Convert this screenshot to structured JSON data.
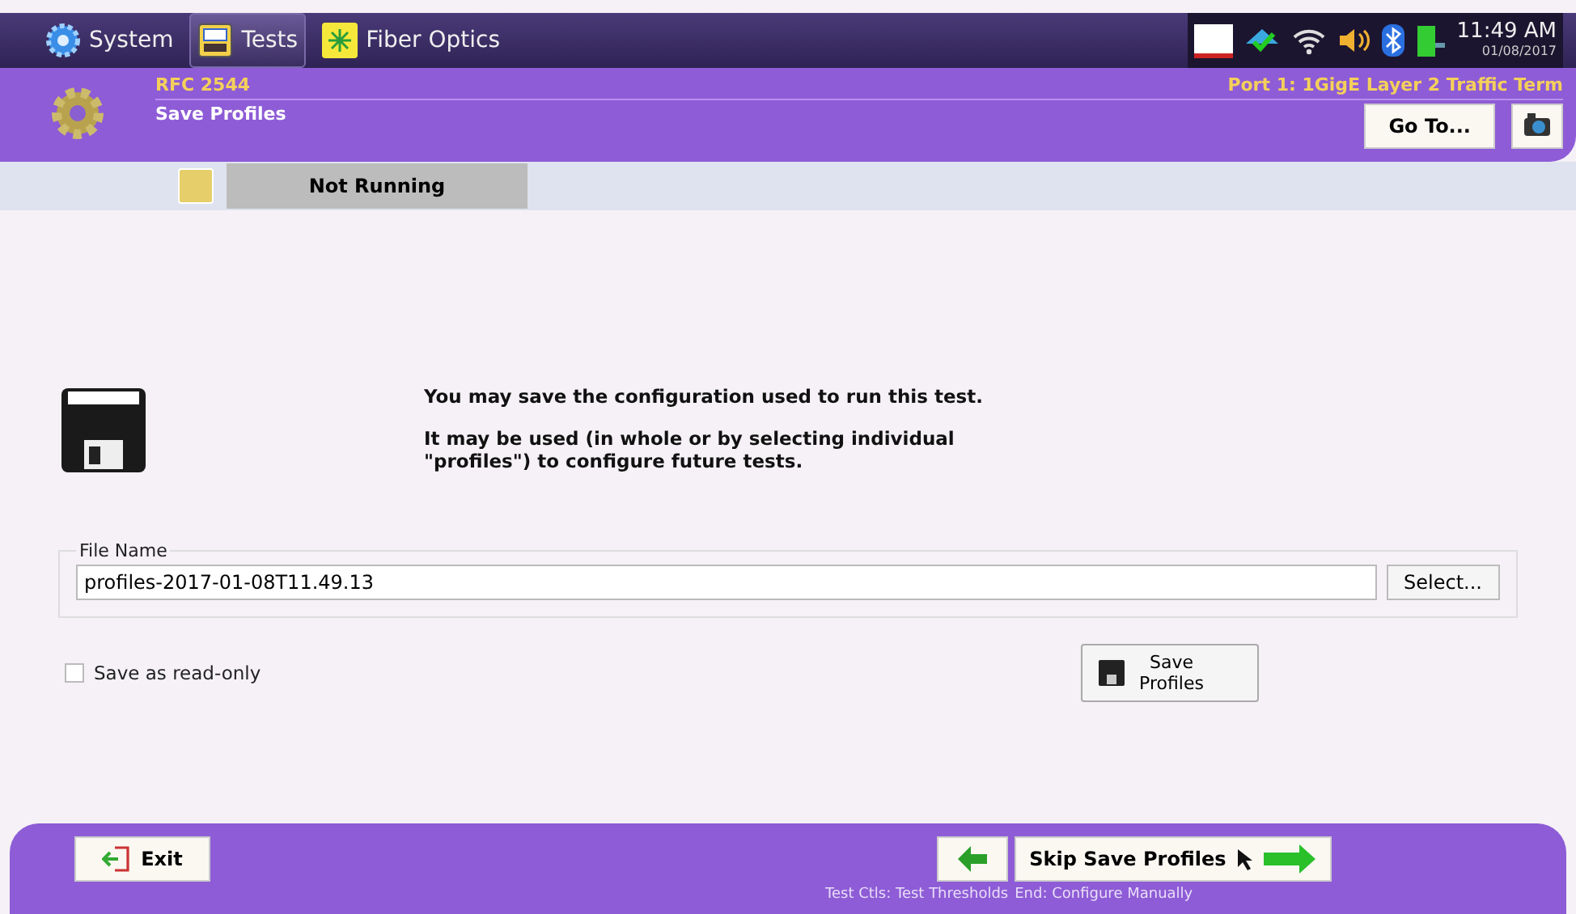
{
  "tabs": [
    {
      "label": "System",
      "kind": "gear",
      "selected": false
    },
    {
      "label": "Tests",
      "kind": "bert",
      "selected": true
    },
    {
      "label": "Fiber Optics",
      "kind": "laser",
      "selected": false
    }
  ],
  "status_tray": {
    "time": "11:49 AM",
    "date": "01/08/2017"
  },
  "header": {
    "test": "RFC 2544",
    "page": "Save Profiles",
    "port": "Port 1: 1GigE Layer 2 Traffic Term",
    "goto": "Go To..."
  },
  "run_status": {
    "label": "Not Running"
  },
  "message": [
    "You may save the configuration used to run this test.",
    "It may be used (in whole or by selecting individual \"profiles\") to configure future tests."
  ],
  "file_name": {
    "legend": "File Name",
    "value": "profiles-2017-01-08T11.49.13",
    "select": "Select..."
  },
  "read_only": {
    "label": "Save as read-only",
    "checked": false
  },
  "save_button": "Save Profiles",
  "footer": {
    "exit": "Exit",
    "back_caption": "Test Ctls: Test Thresholds",
    "next": "Skip Save Profiles",
    "next_caption": "End: Configure Manually"
  }
}
